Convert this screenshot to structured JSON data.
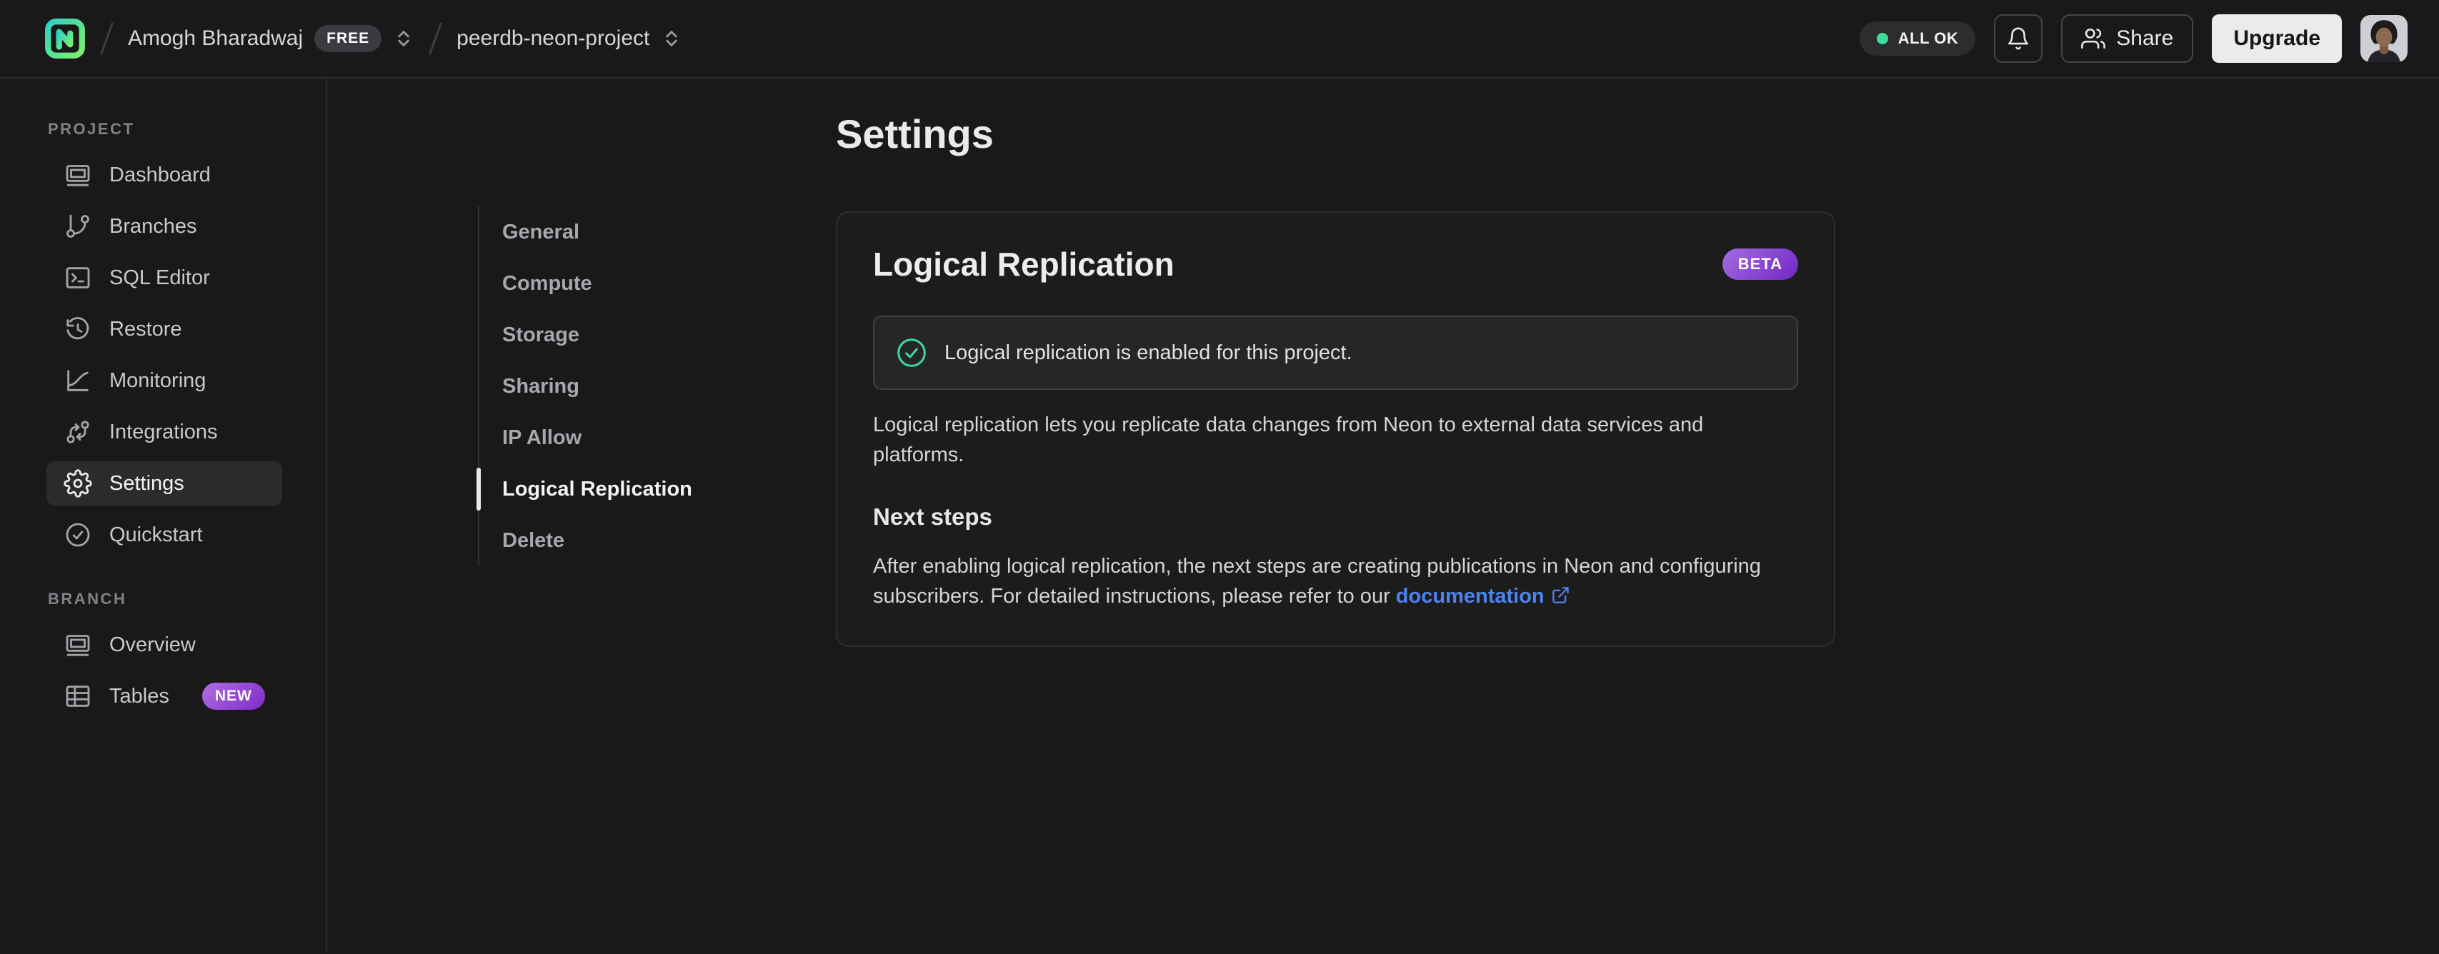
{
  "header": {
    "account": {
      "name": "Amogh Bharadwaj",
      "plan_badge": "FREE"
    },
    "project": {
      "name": "peerdb-neon-project"
    },
    "status_badge": "ALL OK",
    "share_label": "Share",
    "upgrade_label": "Upgrade"
  },
  "sidebar": {
    "sections": [
      {
        "label": "PROJECT",
        "items": [
          {
            "label": "Dashboard"
          },
          {
            "label": "Branches"
          },
          {
            "label": "SQL Editor"
          },
          {
            "label": "Restore"
          },
          {
            "label": "Monitoring"
          },
          {
            "label": "Integrations"
          },
          {
            "label": "Settings",
            "active": true
          },
          {
            "label": "Quickstart"
          }
        ]
      },
      {
        "label": "BRANCH",
        "items": [
          {
            "label": "Overview"
          },
          {
            "label": "Tables",
            "badge": "NEW"
          }
        ]
      }
    ]
  },
  "settings_nav": [
    "General",
    "Compute",
    "Storage",
    "Sharing",
    "IP Allow",
    "Logical Replication",
    "Delete"
  ],
  "main": {
    "page_title": "Settings",
    "card": {
      "title": "Logical Replication",
      "beta_badge": "BETA",
      "alert_text": "Logical replication is enabled for this project.",
      "description": "Logical replication lets you replicate data changes from Neon to external data services and platforms.",
      "next_steps_title": "Next steps",
      "next_steps_text": "After enabling logical replication, the next steps are creating publications in Neon and configuring subscribers. For detailed instructions, please refer to our ",
      "doc_link_label": "documentation"
    }
  },
  "colors": {
    "status_green": "#3edc9a",
    "badge_purple_from": "#a26de2",
    "badge_purple_to": "#7226c3",
    "link_blue": "#4b84ee"
  }
}
